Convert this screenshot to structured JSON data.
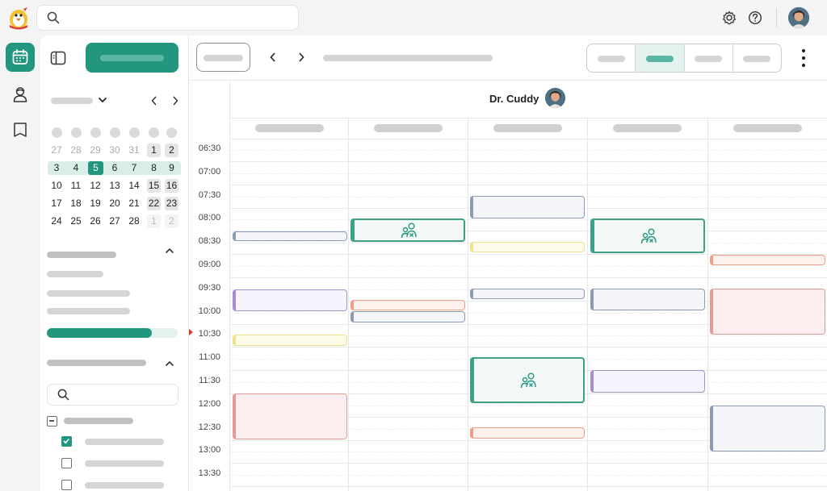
{
  "doctor": {
    "name": "Dr. Cuddy"
  },
  "timeslots": [
    "06:30",
    "07:00",
    "07:30",
    "08:00",
    "08:30",
    "09:00",
    "09:30",
    "10:00",
    "10:30",
    "11:00",
    "11:30",
    "12:00",
    "12:30",
    "13:00",
    "13:30"
  ],
  "mini_calendar": {
    "rows": [
      [
        "27",
        "28",
        "29",
        "30",
        "31",
        "1",
        "2"
      ],
      [
        "3",
        "4",
        "5",
        "6",
        "7",
        "8",
        "9"
      ],
      [
        "10",
        "11",
        "12",
        "13",
        "14",
        "15",
        "16"
      ],
      [
        "17",
        "18",
        "19",
        "20",
        "21",
        "22",
        "23"
      ],
      [
        "24",
        "25",
        "26",
        "27",
        "28",
        "1",
        "2"
      ]
    ],
    "selected_day": "5"
  },
  "icons": {
    "logo": "penguin-logo-icon",
    "search": "search-icon",
    "settings": "gear-icon",
    "help": "help-icon",
    "calendar": "calendar-icon",
    "patients": "person-icon",
    "library": "book-icon",
    "sidebar_toggle": "sidebar-toggle-icon",
    "prev": "chevron-left-icon",
    "next": "chevron-right-icon",
    "more": "more-vertical-icon",
    "group_session": "group-session-icon"
  },
  "colors": {
    "accent": "#239680",
    "now_marker": "#d03a2f"
  }
}
